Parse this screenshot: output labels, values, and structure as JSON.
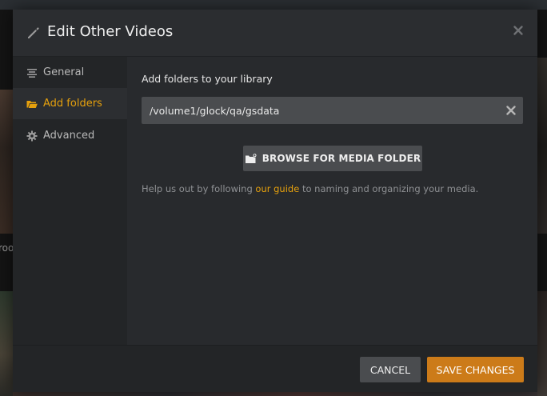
{
  "background": {
    "partial_text": "roo"
  },
  "modal": {
    "title": "Edit Other Videos",
    "close_icon": "close-icon",
    "title_icon": "pencil-icon"
  },
  "sidebar": {
    "items": [
      {
        "label": "General",
        "icon": "list-icon",
        "active": false
      },
      {
        "label": "Add folders",
        "icon": "folder-open-icon",
        "active": true
      },
      {
        "label": "Advanced",
        "icon": "gear-icon",
        "active": false
      }
    ]
  },
  "content": {
    "section_label": "Add folders to your library",
    "folder_path": "/volume1/glock/qa/gsdata",
    "browse_label": "BROWSE FOR MEDIA FOLDER",
    "help_prefix": "Help us out by following ",
    "help_link": "our guide",
    "help_suffix": " to naming and organizing your media."
  },
  "footer": {
    "cancel_label": "CANCEL",
    "save_label": "SAVE CHANGES"
  },
  "colors": {
    "accent": "#e5a00d",
    "save_button": "#cc7b19",
    "modal_bg": "#282a2d",
    "sidebar_bg": "#232527",
    "input_bg": "#4a4c4f"
  }
}
